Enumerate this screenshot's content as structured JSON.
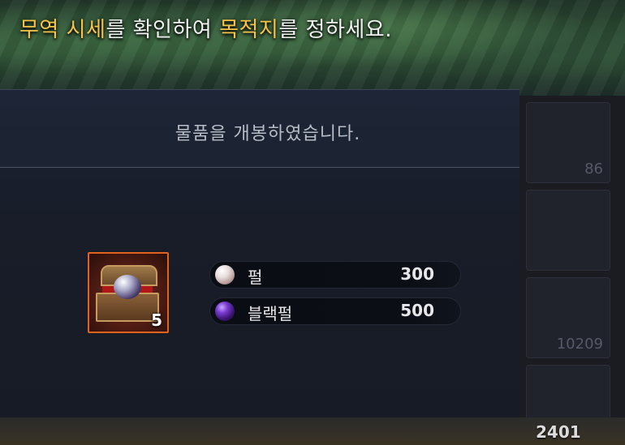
{
  "guide": {
    "part1": "무역 시세",
    "part2": "를 확인하여 ",
    "part3": "목적지",
    "part4": "를 정하세요."
  },
  "popup": {
    "subtitle": "물품을 개봉하였습니다.",
    "item": {
      "quantity": "5",
      "icon": "treasure-chest-icon"
    },
    "rewards": [
      {
        "name": "펄",
        "value": "300",
        "icon": "pearl-icon"
      },
      {
        "name": "블랙펄",
        "value": "500",
        "icon": "black-pearl-icon"
      }
    ]
  },
  "inventory": {
    "counts": [
      "86",
      "10209"
    ]
  },
  "bottom": {
    "count": "2401"
  },
  "colors": {
    "highlight": "#f5c347",
    "item_border": "#e0621c",
    "title_accent": "#e06a1a"
  }
}
